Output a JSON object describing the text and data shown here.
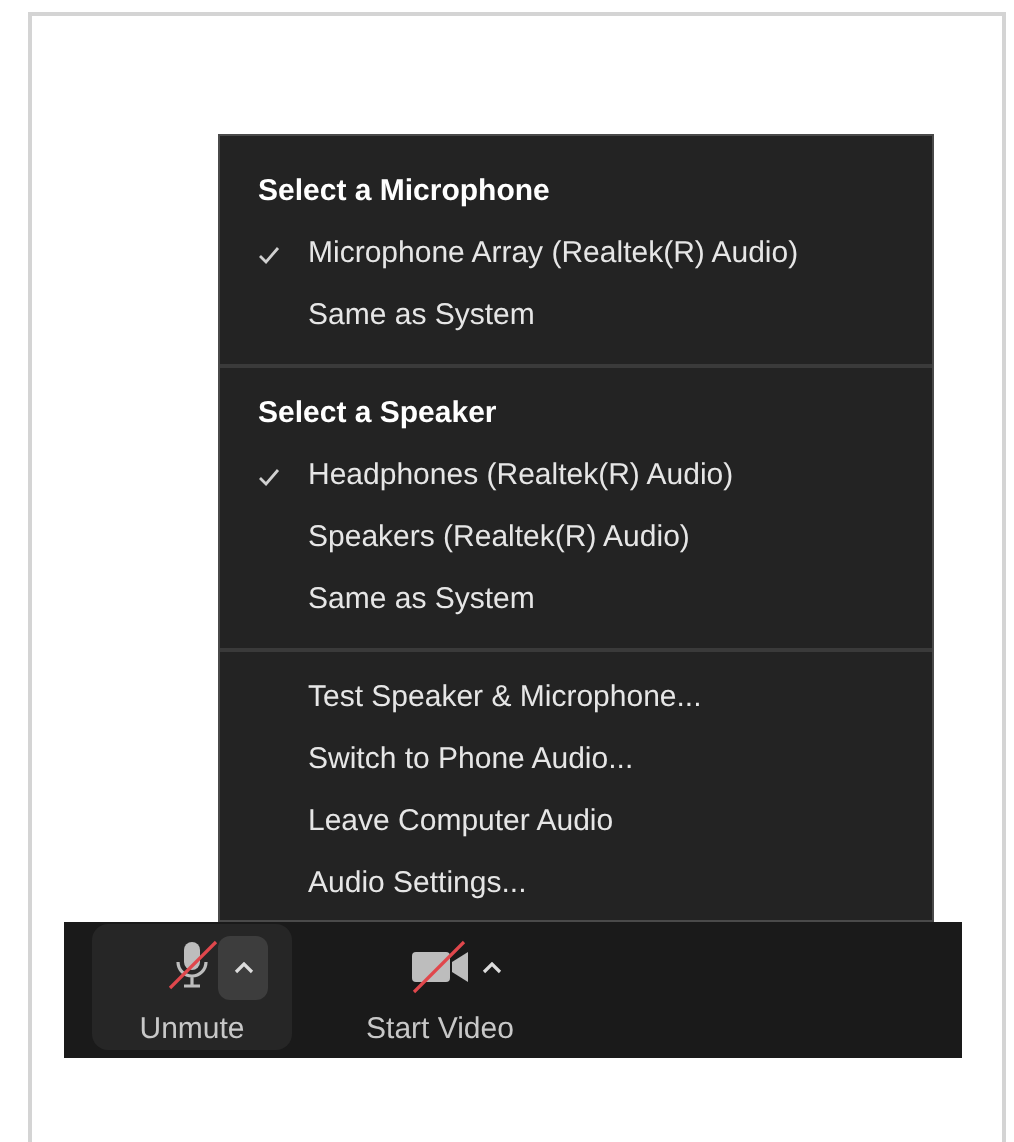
{
  "audio_menu": {
    "sections": [
      {
        "title": "Select a Microphone",
        "items": [
          {
            "label": "Microphone Array (Realtek(R) Audio)",
            "checked": true
          },
          {
            "label": "Same as System",
            "checked": false
          }
        ]
      },
      {
        "title": "Select a Speaker",
        "items": [
          {
            "label": "Headphones (Realtek(R) Audio)",
            "checked": true
          },
          {
            "label": "Speakers (Realtek(R) Audio)",
            "checked": false
          },
          {
            "label": "Same as System",
            "checked": false
          }
        ]
      },
      {
        "items": [
          {
            "label": "Test Speaker & Microphone..."
          },
          {
            "label": "Switch to Phone Audio..."
          },
          {
            "label": "Leave Computer Audio"
          },
          {
            "label": "Audio Settings..."
          }
        ]
      }
    ]
  },
  "toolbar": [
    {
      "kind": "audio",
      "label": "Unmute",
      "muted": true,
      "menu_open": true
    },
    {
      "kind": "video",
      "label": "Start Video",
      "muted": true,
      "menu_open": false
    }
  ]
}
